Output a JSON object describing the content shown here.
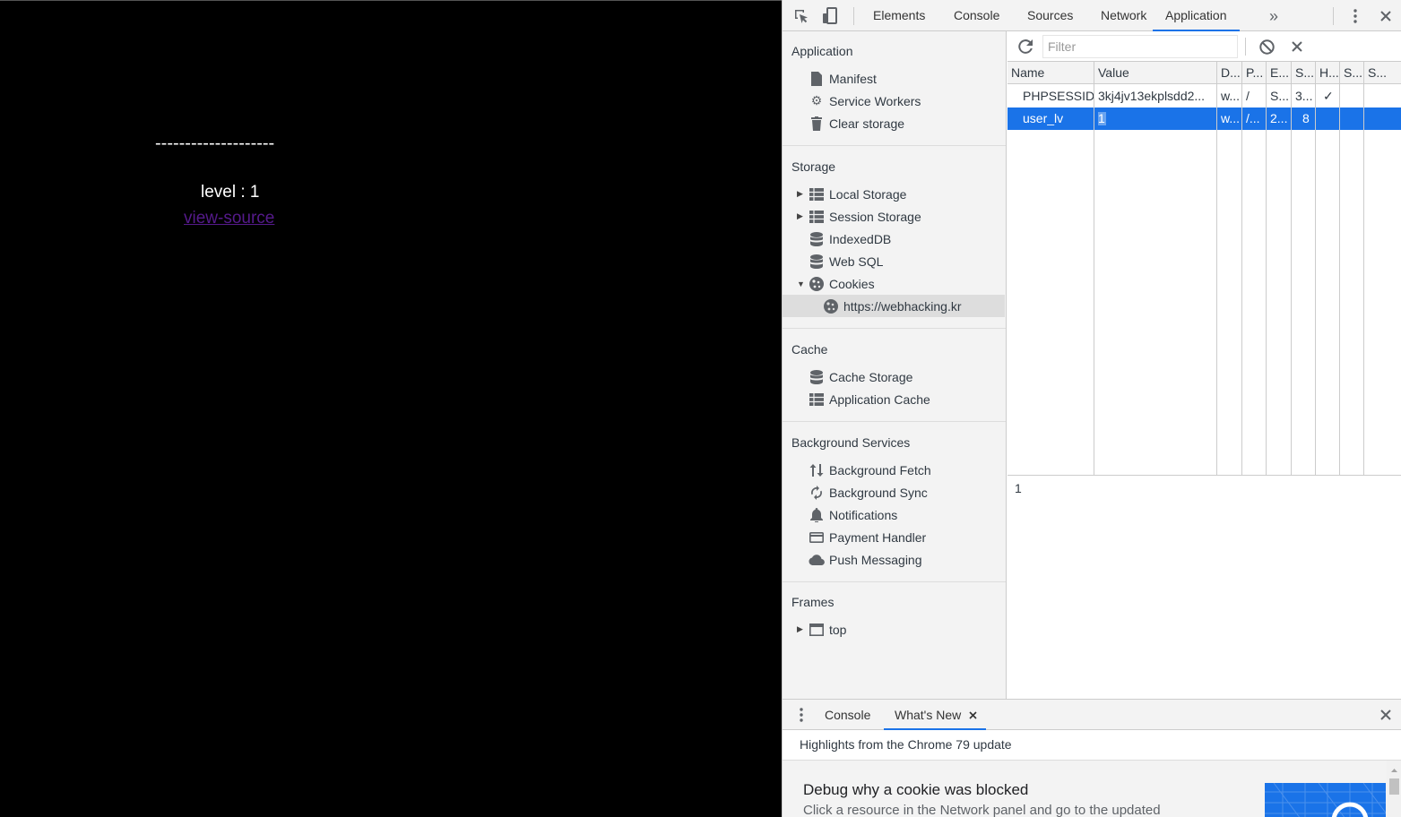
{
  "page": {
    "dashes": "--------------------",
    "level_text": "level : 1",
    "link_text": "view-source"
  },
  "devtools": {
    "tabs": [
      "Elements",
      "Console",
      "Sources",
      "Network",
      "Application"
    ],
    "active_tab": "Application",
    "more_tabs_icon": "»"
  },
  "sidebar": {
    "application": {
      "title": "Application",
      "items": [
        {
          "label": "Manifest",
          "icon": "file-icon"
        },
        {
          "label": "Service Workers",
          "icon": "gear-icon"
        },
        {
          "label": "Clear storage",
          "icon": "trash-icon"
        }
      ]
    },
    "storage": {
      "title": "Storage",
      "items": [
        {
          "label": "Local Storage",
          "icon": "grid-icon"
        },
        {
          "label": "Session Storage",
          "icon": "grid-icon"
        },
        {
          "label": "IndexedDB",
          "icon": "database-icon"
        },
        {
          "label": "Web SQL",
          "icon": "database-icon"
        },
        {
          "label": "Cookies",
          "icon": "cookie-icon"
        },
        {
          "label": "https://webhacking.kr",
          "icon": "cookie-icon"
        }
      ]
    },
    "cache": {
      "title": "Cache",
      "items": [
        {
          "label": "Cache Storage",
          "icon": "database-icon"
        },
        {
          "label": "Application Cache",
          "icon": "grid-icon"
        }
      ]
    },
    "background": {
      "title": "Background Services",
      "items": [
        {
          "label": "Background Fetch",
          "icon": "updown-icon"
        },
        {
          "label": "Background Sync",
          "icon": "sync-icon"
        },
        {
          "label": "Notifications",
          "icon": "bell-icon"
        },
        {
          "label": "Payment Handler",
          "icon": "card-icon"
        },
        {
          "label": "Push Messaging",
          "icon": "cloud-icon"
        }
      ]
    },
    "frames": {
      "title": "Frames",
      "items": [
        {
          "label": "top",
          "icon": "frame-icon"
        }
      ]
    }
  },
  "cookies": {
    "filter_placeholder": "Filter",
    "columns": [
      "Name",
      "Value",
      "D...",
      "P...",
      "E...",
      "S...",
      "H...",
      "S...",
      "S..."
    ],
    "rows": [
      [
        "PHPSESSID",
        "3kj4jv13ekplsdd2...",
        "w...",
        "/",
        "S...",
        "3...",
        "✓",
        "",
        ""
      ],
      [
        "user_lv",
        "1",
        "w...",
        "/...",
        "2...",
        "8",
        "",
        "",
        ""
      ]
    ],
    "selected_row": 1,
    "preview_value": "1"
  },
  "drawer": {
    "tabs": [
      "Console",
      "What's New"
    ],
    "active_tab": "What's New",
    "highlights": "Highlights from the Chrome 79 update",
    "news_title": "Debug why a cookie was blocked",
    "news_text": "Click a resource in the Network panel and go to the updated"
  }
}
